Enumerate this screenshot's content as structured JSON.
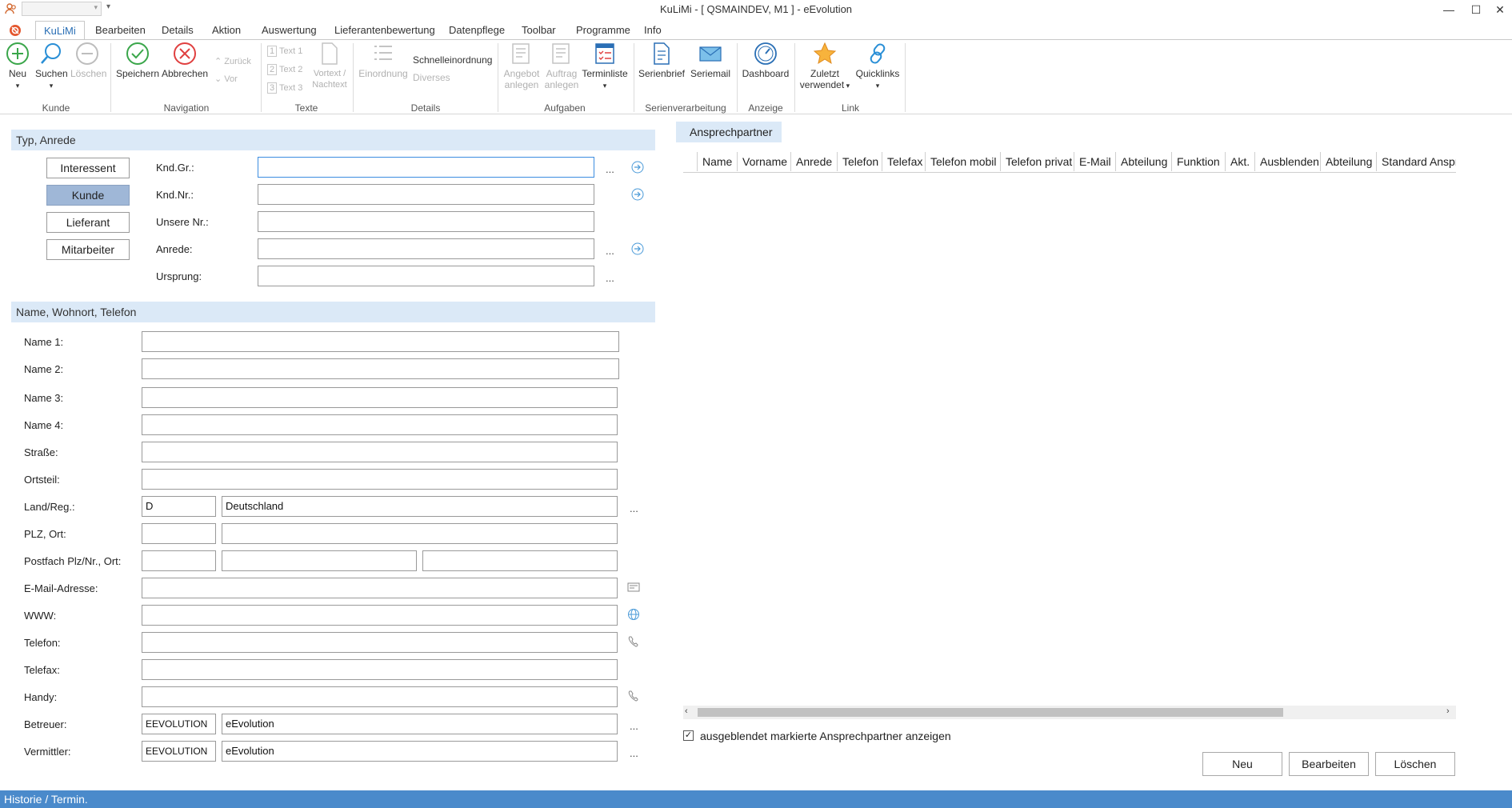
{
  "window": {
    "title": "KuLiMi - [ QSMAINDEV, M1 ]  -  eEvolution",
    "minimize": "—",
    "maximize": "☐",
    "close": "✕"
  },
  "tabs": [
    "KuLiMi",
    "Bearbeiten",
    "Details",
    "Aktion",
    "Auswertung",
    "Lieferantenbewertung",
    "Datenpflege",
    "Toolbar",
    "Programme",
    "Info"
  ],
  "ribbon": {
    "groups": {
      "kunde": "Kunde",
      "navigation": "Navigation",
      "texte": "Texte",
      "details": "Details",
      "aufgaben": "Aufgaben",
      "serienverarbeitung": "Serienverarbeitung",
      "anzeige": "Anzeige",
      "link": "Link"
    },
    "buttons": {
      "neu": "Neu",
      "suchen": "Suchen",
      "loeschen": "Löschen",
      "speichern": "Speichern",
      "abbrechen": "Abbrechen",
      "zurueck": "Zurück",
      "vor": "Vor",
      "text1": "Text 1",
      "text2": "Text 2",
      "text3": "Text 3",
      "vortext_1": "Vortext /",
      "vortext_2": "Nachtext",
      "einordnung": "Einordnung",
      "schnelleinordnung": "Schnelleinordnung",
      "diverses": "Diverses",
      "angebot_1": "Angebot",
      "angebot_2": "anlegen",
      "auftrag_1": "Auftrag",
      "auftrag_2": "anlegen",
      "terminliste": "Terminliste",
      "serienbrief": "Serienbrief",
      "seriemail": "Seriemail",
      "dashboard": "Dashboard",
      "zuletzt_1": "Zuletzt",
      "zuletzt_2": "verwendet",
      "quicklinks": "Quicklinks"
    }
  },
  "typ_anrede": {
    "header": "Typ, Anrede",
    "types": [
      "Interessent",
      "Kunde",
      "Lieferant",
      "Mitarbeiter"
    ],
    "selected": "Kunde",
    "fields": {
      "kndgr": {
        "label": "Knd.Gr.:",
        "value": ""
      },
      "kndnr": {
        "label": "Knd.Nr.:",
        "value": ""
      },
      "unsere_nr": {
        "label": "Unsere Nr.:",
        "value": ""
      },
      "anrede": {
        "label": "Anrede:",
        "value": ""
      },
      "ursprung": {
        "label": "Ursprung:",
        "value": ""
      }
    }
  },
  "name_section": {
    "header": "Name, Wohnort, Telefon",
    "name1": "Name 1:",
    "name2": "Name 2:",
    "name3": "Name 3:",
    "name4": "Name 4:",
    "strasse": "Straße:",
    "ortsteil": "Ortsteil:",
    "land_label": "Land/Reg.:",
    "land_code": "D",
    "land_name": "Deutschland",
    "plz_label": "PLZ, Ort:",
    "postfach_label": "Postfach Plz/Nr., Ort:",
    "email_label": "E-Mail-Adresse:",
    "www_label": "WWW:",
    "telefon_label": "Telefon:",
    "telefax_label": "Telefax:",
    "handy_label": "Handy:",
    "betreuer_label": "Betreuer:",
    "betreuer_code": "EEVOLUTION",
    "betreuer_name": "eEvolution",
    "vermittler_label": "Vermittler:",
    "vermittler_code": "EEVOLUTION",
    "vermittler_name": "eEvolution"
  },
  "ansprechpartner": {
    "tab": "Ansprechpartner",
    "columns": [
      "Name",
      "Vorname",
      "Anrede",
      "Telefon",
      "Telefax",
      "Telefon mobil",
      "Telefon privat",
      "E-Mail",
      "Abteilung",
      "Funktion",
      "Akt.",
      "Ausblenden",
      "Abteilung",
      "Standard Ansprec"
    ],
    "checkbox_label": "ausgeblendet markierte Ansprechpartner anzeigen",
    "checkbox_checked": true,
    "btn_neu": "Neu",
    "btn_bearbeiten": "Bearbeiten",
    "btn_loeschen": "Löschen"
  },
  "status": "Historie / Termin."
}
